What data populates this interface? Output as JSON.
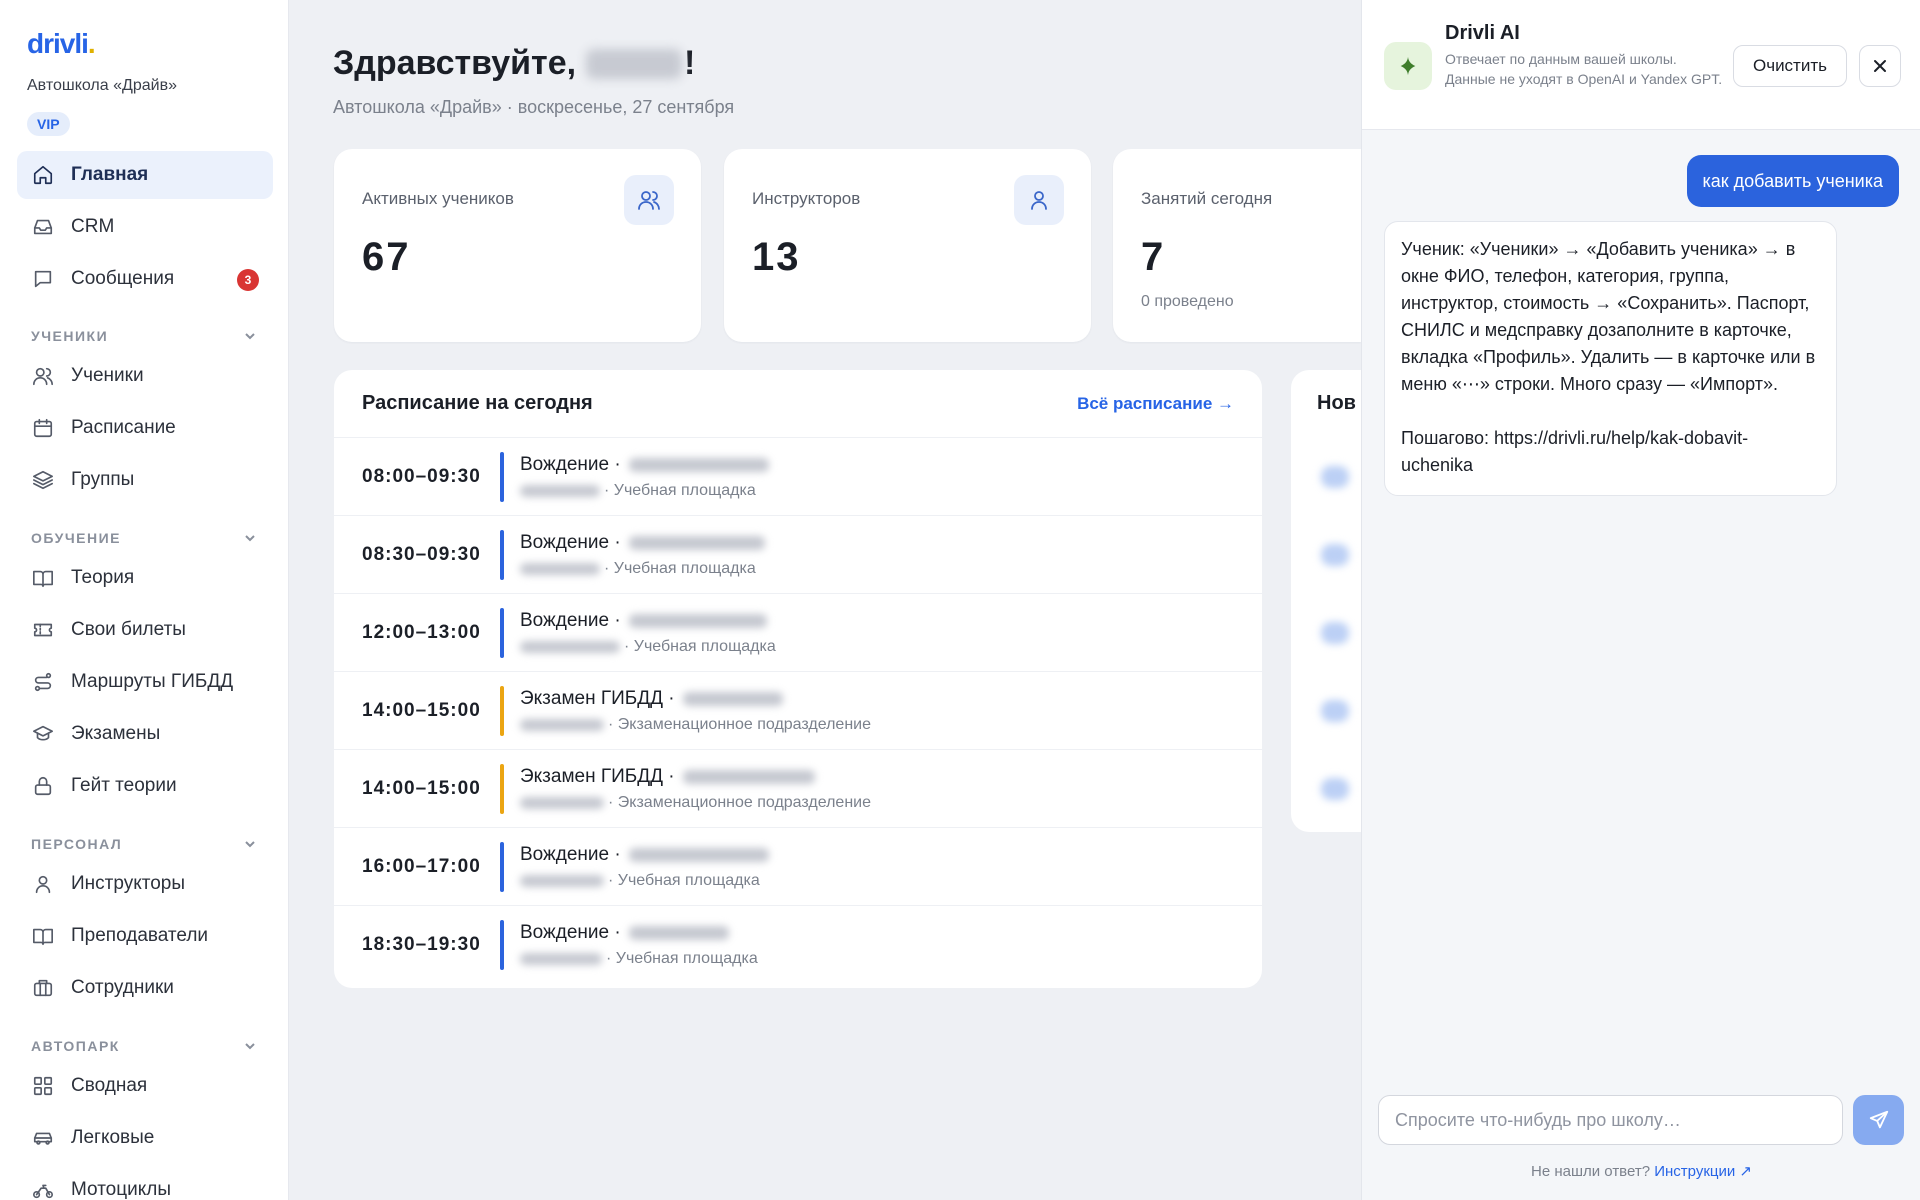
{
  "brand": {
    "logo": "drivli",
    "logo_dot": ".",
    "school": "Автошкола «Драйв»",
    "tier": "VIP"
  },
  "sidebar": {
    "top": [
      {
        "label": "Главная",
        "icon": "home-icon",
        "active": true
      },
      {
        "label": "CRM",
        "icon": "inbox-icon"
      },
      {
        "label": "Сообщения",
        "icon": "chat-icon",
        "badge": "3"
      }
    ],
    "sections": [
      {
        "title": "УЧЕНИКИ",
        "items": [
          {
            "label": "Ученики",
            "icon": "users-icon"
          },
          {
            "label": "Расписание",
            "icon": "calendar-icon"
          },
          {
            "label": "Группы",
            "icon": "layers-icon"
          }
        ]
      },
      {
        "title": "ОБУЧЕНИЕ",
        "items": [
          {
            "label": "Теория",
            "icon": "book-icon"
          },
          {
            "label": "Свои билеты",
            "icon": "ticket-icon"
          },
          {
            "label": "Маршруты ГИБДД",
            "icon": "route-icon"
          },
          {
            "label": "Экзамены",
            "icon": "graduation-cap-icon"
          },
          {
            "label": "Гейт теории",
            "icon": "lock-icon"
          }
        ]
      },
      {
        "title": "ПЕРСОНАЛ",
        "items": [
          {
            "label": "Инструкторы",
            "icon": "user-icon"
          },
          {
            "label": "Преподаватели",
            "icon": "book-open-icon"
          },
          {
            "label": "Сотрудники",
            "icon": "briefcase-icon"
          }
        ]
      },
      {
        "title": "АВТОПАРК",
        "items": [
          {
            "label": "Сводная",
            "icon": "grid-icon"
          },
          {
            "label": "Легковые",
            "icon": "car-icon"
          },
          {
            "label": "Мотоциклы",
            "icon": "motorcycle-icon"
          }
        ]
      }
    ]
  },
  "main": {
    "greeting_prefix": "Здравствуйте,",
    "greeting_suffix": "!",
    "subtitle": "Автошкола «Драйв» · воскресенье, 27 сентября",
    "stats": [
      {
        "label": "Активных учеников",
        "value": "67",
        "icon": "users-icon"
      },
      {
        "label": "Инструкторов",
        "value": "13",
        "icon": "user-icon"
      },
      {
        "label": "Занятий сегодня",
        "value": "7",
        "note": "0 проведено"
      }
    ],
    "schedule": {
      "title": "Расписание на сегодня",
      "link": "Всё расписание →",
      "rows": [
        {
          "time": "08:00–09:30",
          "type": "Вождение ·",
          "place": "· Учебная площадка",
          "kind": "drive"
        },
        {
          "time": "08:30–09:30",
          "type": "Вождение ·",
          "place": "· Учебная площадка",
          "kind": "drive"
        },
        {
          "time": "12:00–13:00",
          "type": "Вождение ·",
          "place": "· Учебная площадка",
          "kind": "drive"
        },
        {
          "time": "14:00–15:00",
          "type": "Экзамен ГИБДД ·",
          "place": "· Экзаменационное подразделение",
          "kind": "exam"
        },
        {
          "time": "14:00–15:00",
          "type": "Экзамен ГИБДД ·",
          "place": "· Экзаменационное подразделение",
          "kind": "exam"
        },
        {
          "time": "16:00–17:00",
          "type": "Вождение ·",
          "place": "· Учебная площадка",
          "kind": "drive"
        },
        {
          "time": "18:30–19:30",
          "type": "Вождение ·",
          "place": "· Учебная площадка",
          "kind": "drive"
        }
      ]
    },
    "news_title": "Нов"
  },
  "ai": {
    "title": "Drivli AI",
    "description": "Отвечает по данным вашей школы. Данные не уходят в OpenAI и Yandex GPT.",
    "clear_label": "Очистить",
    "user_message": "как добавить ученика",
    "bot_message_p1": "Ученик: «Ученики» → «Добавить ученика» → в окне ФИО, телефон, категория, группа, инструктор, стоимость → «Сохранить». Паспорт, СНИЛС и медсправку дозаполните в карточке, вкладка «Профиль». Удалить — в карточке или в меню «⋯» строки. Много сразу — «Импорт».",
    "bot_message_p2": "Пошагово: https://drivli.ru/help/kak-dobavit-uchenika",
    "input_placeholder": "Спросите что-нибудь про школу…",
    "footer_text": "Не нашли ответ?",
    "footer_link": "Инструкции ↗"
  },
  "colors": {
    "accent": "#2b63dd",
    "exam": "#eba512",
    "badge": "#d93533"
  }
}
